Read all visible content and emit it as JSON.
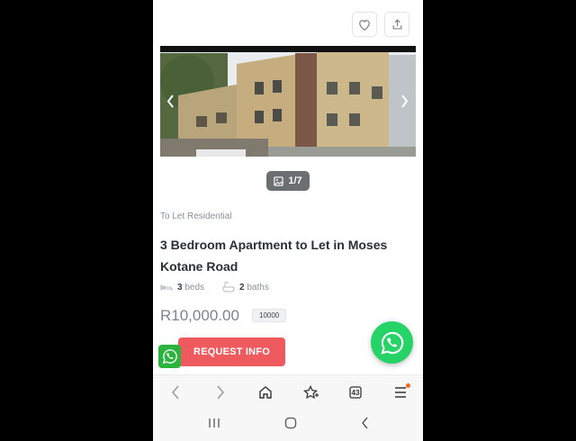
{
  "listing": {
    "image_counter": "1/7",
    "category": "To Let Residential",
    "title": "3 Bedroom Apartment to Let in Moses Kotane Road",
    "beds_count": "3",
    "beds_label": "beds",
    "baths_count": "2",
    "baths_label": "baths",
    "price": "R10,000.00",
    "price_badge": "10000",
    "request_label": "REQUEST INFO"
  },
  "browser": {
    "tabs_count": "43"
  },
  "colors": {
    "accent": "#ef5a5e",
    "whatsapp": "#26d366",
    "notification_dot": "#f26a1b"
  }
}
